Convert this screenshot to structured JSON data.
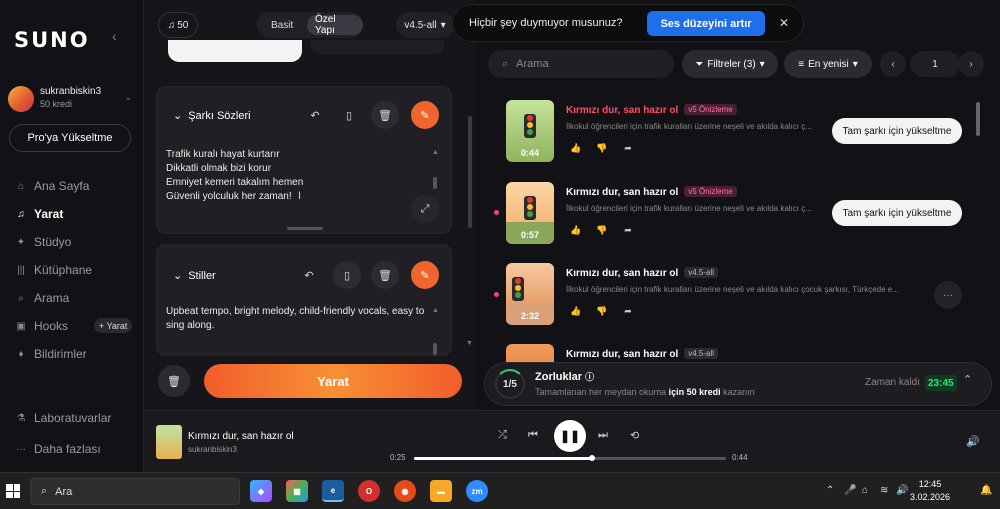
{
  "sidebar": {
    "logo": "SUNO",
    "collapse_icon": "‹",
    "user": {
      "name": "sukranbiskin3",
      "credits": "50 kredi"
    },
    "upgrade_label": "Pro'ya Yükseltme",
    "nav": [
      {
        "label": "Ana Sayfa",
        "icon": "⌂"
      },
      {
        "label": "Yarat",
        "icon": "♫"
      },
      {
        "label": "Stüdyo",
        "icon": "✦"
      },
      {
        "label": "Kütüphane",
        "icon": "|||"
      },
      {
        "label": "Arama",
        "icon": "⌕"
      },
      {
        "label": "Hooks",
        "icon": "▣"
      },
      {
        "label": "Bildirimler",
        "icon": "♦"
      },
      {
        "label": "Laboratuvarlar",
        "icon": "⚗"
      },
      {
        "label": "Daha fazlası",
        "icon": "···"
      }
    ],
    "hooks_badge": "+ Yarat"
  },
  "create_panel": {
    "credits": "50",
    "mode_simple": "Basit",
    "mode_custom": "Özel Yapı",
    "version": "v4.5-all",
    "lyrics_title": "Şarkı Sözleri",
    "lyrics": [
      "Trafik kuralı hayat kurtarır",
      "Dikkatli olmak bizi korur",
      "Emniyet kemeri takalım hemen",
      "Güvenli yolculuk her zaman!"
    ],
    "styles_title": "Stiller",
    "styles_text": "Upbeat tempo, bright melody, child-friendly vocals, easy to sing along.",
    "create_label": "Yarat"
  },
  "toast": {
    "text": "Hiçbir şey duymuyor musunuz?",
    "button": "Ses düzeyini artır",
    "close": "✕"
  },
  "library": {
    "search_placeholder": "Arama",
    "filters_label": "Filtreler (3)",
    "sort_label": "En yenisi",
    "page": "1",
    "songs": [
      {
        "title": "Kırmızı dur, san hazır ol",
        "tag": "v5 Önizleme",
        "desc": "İlkokul öğrencileri için trafik kuralları üzerine neşeli ve akılda kalıcı ç...",
        "duration": "0:44",
        "upgrade": "Tam şarkı için yükseltme"
      },
      {
        "title": "Kırmızı dur, san hazır ol",
        "tag": "v5 Önizleme",
        "desc": "İlkokul öğrencileri için trafik kuralları üzerine neşeli ve akılda kalıcı ç...",
        "duration": "0:57",
        "upgrade": "Tam şarkı için yükseltme"
      },
      {
        "title": "Kırmızı dur, san hazır ol",
        "tag": "v4.5-all",
        "desc": "İlkokul öğrencileri için trafik kuralları üzerine neşeli ve akılda kalıcı çocuk şarkısı, Türkçede e...",
        "duration": "2:32",
        "upgrade": ""
      },
      {
        "title": "Kırmızı dur, san hazır ol",
        "tag": "v4.5-all",
        "desc": "",
        "duration": "",
        "upgrade": ""
      }
    ]
  },
  "challenge": {
    "progress": "1/5",
    "title": "Zorluklar",
    "sub_prefix": "Tamamlanan her meydan okuma ",
    "sub_bold": "için 50 kredi",
    "sub_suffix": " kazanın",
    "time_label": "Zaman kaldı",
    "timer": "23:45"
  },
  "player": {
    "title": "Kırmızı dur, san hazır ol",
    "artist": "sukranbiskin3",
    "current": "0:25",
    "total": "0:44",
    "progress": 0.57
  },
  "taskbar": {
    "search": "Ara",
    "time": "12:45",
    "date": "3.02.2026"
  },
  "colors": {
    "accent": "#f0642d",
    "toast_button": "#1f6feb",
    "timer": "#2ee37a"
  }
}
